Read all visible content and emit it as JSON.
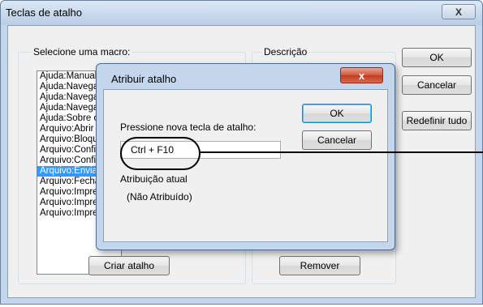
{
  "window": {
    "title": "Teclas de atalho",
    "close_glyph": "X"
  },
  "macros": {
    "label": "Selecione uma macro:",
    "items": [
      "Ajuda:Manual",
      "Ajuda:Navega",
      "Ajuda:Navega",
      "Ajuda:Navega",
      "Ajuda:Sobre o",
      "Arquivo:Abrir",
      "Arquivo:Bloqu",
      "Arquivo:Config",
      "Arquivo:Config",
      "Arquivo:Envia",
      "Arquivo:Fecha",
      "Arquivo:Impre",
      "Arquivo:Impre",
      "Arquivo:Impre"
    ],
    "selected_index": 9,
    "create_button": "Criar atalho"
  },
  "description": {
    "label": "Descrição",
    "remove_button": "Remover"
  },
  "buttons": {
    "ok": "OK",
    "cancel": "Cancelar",
    "reset_all": "Redefinir tudo"
  },
  "dialog": {
    "title": "Atribuir atalho",
    "close_glyph": "x",
    "prompt": "Pressione nova tecla de atalho:",
    "key_value": "Ctrl + F10",
    "current_label": "Atribuição atual",
    "current_value": "(Não Atribuído)",
    "ok": "OK",
    "cancel": "Cancelar"
  },
  "colors": {
    "selection": "#3399ff",
    "close_red": "#c13c22",
    "frame": "#c3d6ec"
  }
}
